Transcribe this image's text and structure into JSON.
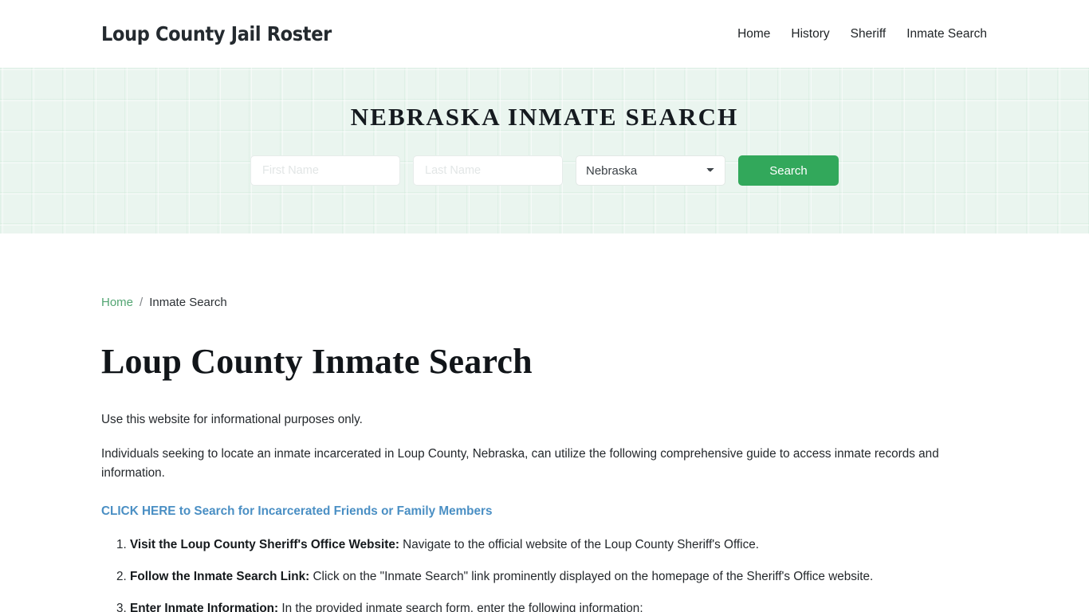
{
  "header": {
    "brand": "Loup County Jail Roster",
    "nav": [
      {
        "label": "Home"
      },
      {
        "label": "History"
      },
      {
        "label": "Sheriff"
      },
      {
        "label": "Inmate Search"
      }
    ]
  },
  "hero": {
    "title": "NEBRASKA INMATE SEARCH",
    "form": {
      "first_name_placeholder": "First Name",
      "first_name_value": "",
      "last_name_placeholder": "Last Name",
      "last_name_value": "",
      "state_selected": "Nebraska",
      "state_options": [
        "Nebraska"
      ],
      "search_label": "Search"
    },
    "background_color": "#eaf5ef",
    "button_color": "#32a85b"
  },
  "breadcrumb": {
    "home": "Home",
    "separator": "/",
    "current": "Inmate Search",
    "link_color": "#52a572"
  },
  "main": {
    "page_title": "Loup County Inmate Search",
    "paragraph_1": "Use this website for informational purposes only.",
    "paragraph_2": "Individuals seeking to locate an inmate incarcerated in Loup County, Nebraska, can utilize the following comprehensive guide to access inmate records and information.",
    "cta_label": "CLICK HERE to Search for Incarcerated Friends or Family Members",
    "cta_color": "#4a8fc4",
    "steps": [
      {
        "bold": "Visit the Loup County Sheriff's Office Website:",
        "text": " Navigate to the official website of the Loup County Sheriff's Office."
      },
      {
        "bold": "Follow the Inmate Search Link:",
        "text": " Click on the \"Inmate Search\" link prominently displayed on the homepage of the Sheriff's Office website."
      },
      {
        "bold": "Enter Inmate Information:",
        "text": " In the provided inmate search form, enter the following information:"
      }
    ]
  }
}
